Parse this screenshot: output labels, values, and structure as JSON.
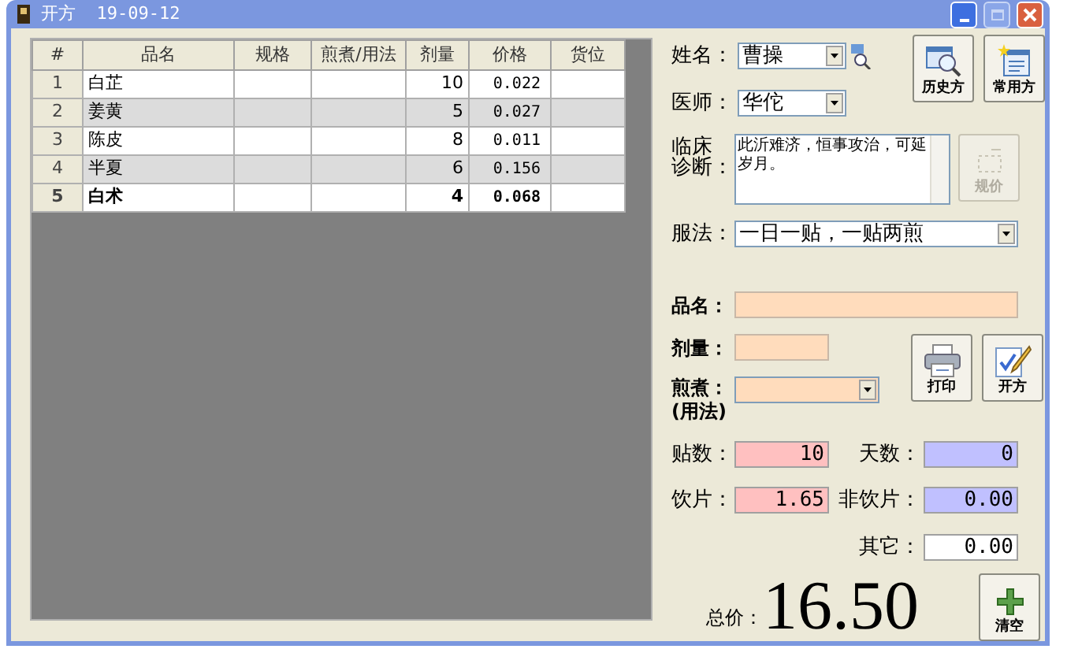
{
  "window": {
    "title": "开方  19-09-12"
  },
  "table": {
    "columns": [
      "#",
      "品名",
      "规格",
      "煎煮/用法",
      "剂量",
      "价格",
      "货位"
    ],
    "rows": [
      {
        "index": "1",
        "name": "白芷",
        "dose": "10",
        "price": "0.022",
        "selected": false
      },
      {
        "index": "2",
        "name": "姜黄",
        "dose": "5",
        "price": "0.027",
        "selected": false
      },
      {
        "index": "3",
        "name": "陈皮",
        "dose": "8",
        "price": "0.011",
        "selected": false
      },
      {
        "index": "4",
        "name": "半夏",
        "dose": "6",
        "price": "0.156",
        "selected": false
      },
      {
        "index": "5",
        "name": "白术",
        "dose": "4",
        "price": "0.068",
        "selected": true
      }
    ]
  },
  "patient": {
    "label": "姓名：",
    "value": "曹操"
  },
  "doctor": {
    "label": "医师：",
    "value": "华佗"
  },
  "diagnosis": {
    "label": [
      "临床",
      "诊断："
    ],
    "value": "此沂难济，恒事攻治，可延岁月。"
  },
  "usage": {
    "label": "服法：",
    "value": "一日一贴，一贴两煎"
  },
  "buttons": [
    {
      "kind": "history",
      "label": "历史方",
      "disabled": false
    },
    {
      "kind": "common",
      "label": "常用方",
      "disabled": false
    },
    {
      "kind": "price",
      "label": "规价",
      "disabled": true
    },
    {
      "kind": "print",
      "label": "打印",
      "disabled": false
    },
    {
      "kind": "prescribe",
      "label": "开方",
      "disabled": false
    },
    {
      "kind": "clear",
      "label": "清空",
      "disabled": false
    }
  ],
  "herb_name": {
    "label": "品名："
  },
  "herb_dose": {
    "label": "剂量："
  },
  "decoction": {
    "label": [
      "煎煮：",
      "(用法)"
    ]
  },
  "summary": [
    {
      "label": "贴数：",
      "value": "10",
      "color": "#ffc0c0"
    },
    {
      "label": "天数：",
      "value": "0",
      "color": "#c0c0ff"
    },
    {
      "label": "饮片：",
      "value": "1.65",
      "color": "#ffc0c0"
    },
    {
      "label": "非饮片：",
      "value": "0.00",
      "color": "#c0c0ff"
    },
    {
      "label": "其它：",
      "value": "0.00",
      "color": "#ffffff"
    }
  ],
  "total": {
    "label": "总价：",
    "value": "16.50"
  }
}
